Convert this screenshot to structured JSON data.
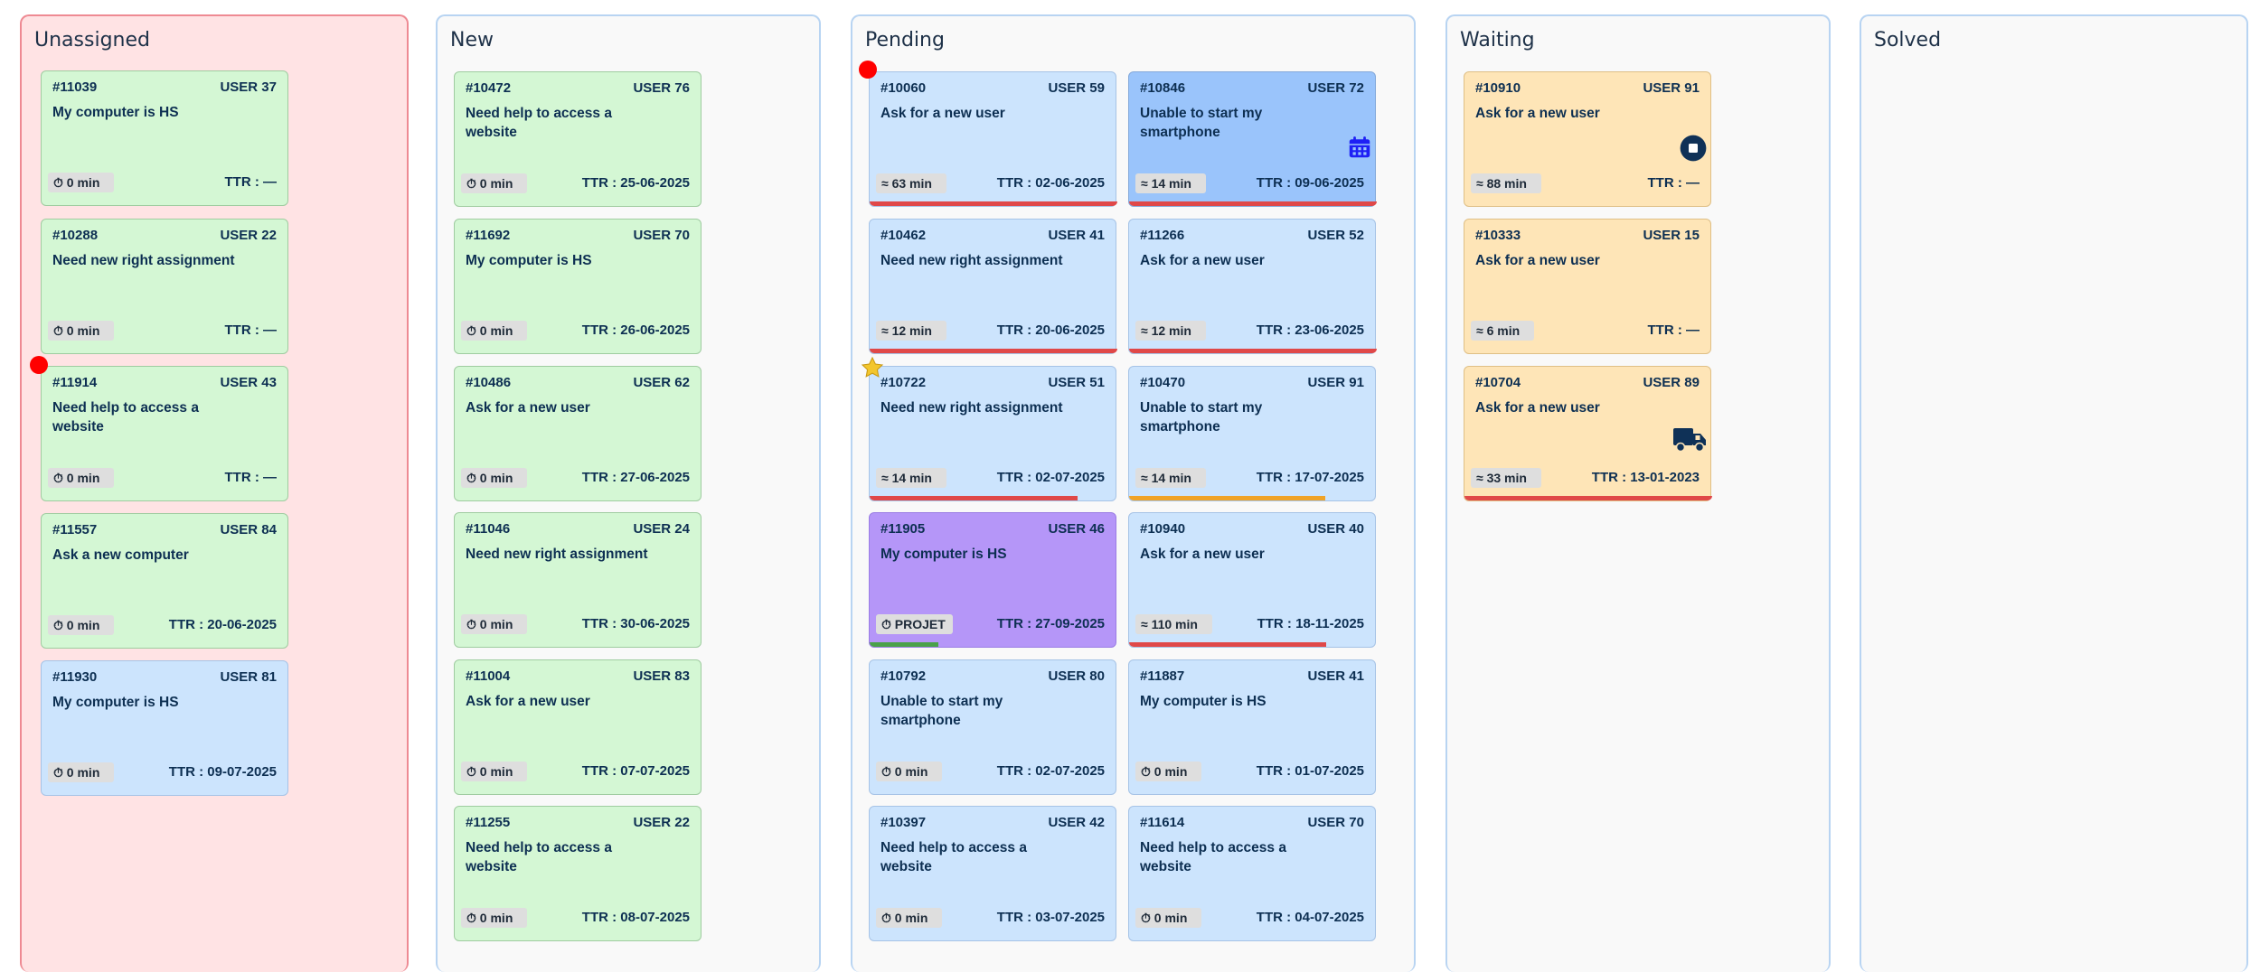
{
  "colors": {
    "unassigned_bg": "#ffe3e4",
    "green_card": "#d4f7d4",
    "blue_card": "#cce4fd",
    "darkblue_card": "#9ac4fb",
    "purple_card": "#b596f8",
    "orange_card": "#fee5b7",
    "bar_red": "#e04848",
    "bar_orange": "#f0a327",
    "bar_green": "#4aa14a",
    "marker_red": "#ff0000"
  },
  "columns": [
    {
      "title": "Unassigned"
    },
    {
      "title": "New"
    },
    {
      "title": "Pending"
    },
    {
      "title": "Waiting"
    },
    {
      "title": "Solved"
    }
  ],
  "unassigned": [
    {
      "id": "#11039",
      "user": "USER 37",
      "title": "My computer is HS",
      "time": "⏱ 0 min",
      "ttr": "TTR : —"
    },
    {
      "id": "#10288",
      "user": "USER 22",
      "title": "Need new right assignment",
      "time": "⏱ 0 min",
      "ttr": "TTR : —"
    },
    {
      "id": "#11914",
      "user": "USER 43",
      "title": "Need help to access a website",
      "time": "⏱ 0 min",
      "ttr": "TTR : —"
    },
    {
      "id": "#11557",
      "user": "USER 84",
      "title": "Ask a new computer",
      "time": "⏱ 0 min",
      "ttr": "TTR : 20-06-2025"
    },
    {
      "id": "#11930",
      "user": "USER 81",
      "title": "My computer is HS",
      "time": "⏱ 0 min",
      "ttr": "TTR : 09-07-2025"
    }
  ],
  "new": [
    {
      "id": "#10472",
      "user": "USER 76",
      "title": "Need help to access a website",
      "time": "⏱ 0 min",
      "ttr": "TTR : 25-06-2025"
    },
    {
      "id": "#11692",
      "user": "USER 70",
      "title": "My computer is HS",
      "time": "⏱ 0 min",
      "ttr": "TTR : 26-06-2025"
    },
    {
      "id": "#10486",
      "user": "USER 62",
      "title": "Ask for a new user",
      "time": "⏱ 0 min",
      "ttr": "TTR : 27-06-2025"
    },
    {
      "id": "#11046",
      "user": "USER 24",
      "title": "Need new right assignment",
      "time": "⏱ 0 min",
      "ttr": "TTR : 30-06-2025"
    },
    {
      "id": "#11004",
      "user": "USER 83",
      "title": "Ask for a new user",
      "time": "⏱ 0 min",
      "ttr": "TTR : 07-07-2025"
    },
    {
      "id": "#11255",
      "user": "USER 22",
      "title": "Need help to access a website",
      "time": "⏱ 0 min",
      "ttr": "TTR : 08-07-2025"
    }
  ],
  "pending_left": [
    {
      "id": "#10060",
      "user": "USER 59",
      "title": "Ask for a new user",
      "time": "≈ 63 min",
      "ttr": "TTR : 02-06-2025"
    },
    {
      "id": "#10462",
      "user": "USER 41",
      "title": "Need new right assignment",
      "time": "≈ 12 min",
      "ttr": "TTR : 20-06-2025"
    },
    {
      "id": "#10722",
      "user": "USER 51",
      "title": "Need new right assignment",
      "time": "≈ 14 min",
      "ttr": "TTR : 02-07-2025"
    },
    {
      "id": "#11905",
      "user": "USER 46",
      "title": "My computer is HS",
      "time": "⏱ PROJET",
      "ttr": "TTR : 27-09-2025"
    },
    {
      "id": "#10792",
      "user": "USER 80",
      "title": "Unable to start my smartphone",
      "time": "⏱ 0 min",
      "ttr": "TTR : 02-07-2025"
    },
    {
      "id": "#10397",
      "user": "USER 42",
      "title": "Need help to access a website",
      "time": "⏱ 0 min",
      "ttr": "TTR : 03-07-2025"
    }
  ],
  "pending_right": [
    {
      "id": "#10846",
      "user": "USER 72",
      "title": "Unable to start my smartphone",
      "time": "≈ 14 min",
      "ttr": "TTR : 09-06-2025",
      "icon": "calendar-icon"
    },
    {
      "id": "#11266",
      "user": "USER 52",
      "title": "Ask for a new user",
      "time": "≈ 12 min",
      "ttr": "TTR : 23-06-2025"
    },
    {
      "id": "#10470",
      "user": "USER 91",
      "title": "Unable to start my smartphone",
      "time": "≈ 14 min",
      "ttr": "TTR : 17-07-2025"
    },
    {
      "id": "#10940",
      "user": "USER 40",
      "title": "Ask for a new user",
      "time": "≈ 110 min",
      "ttr": "TTR : 18-11-2025"
    },
    {
      "id": "#11887",
      "user": "USER 41",
      "title": "My computer is HS",
      "time": "⏱ 0 min",
      "ttr": "TTR : 01-07-2025"
    },
    {
      "id": "#11614",
      "user": "USER 70",
      "title": "Need help to access a website",
      "time": "⏱ 0 min",
      "ttr": "TTR : 04-07-2025"
    }
  ],
  "waiting": [
    {
      "id": "#10910",
      "user": "USER 91",
      "title": "Ask for a new user",
      "time": "≈ 88 min",
      "ttr": "TTR : —",
      "icon": "stop-icon"
    },
    {
      "id": "#10333",
      "user": "USER 15",
      "title": "Ask for a new user",
      "time": "≈ 6 min",
      "ttr": "TTR : —"
    },
    {
      "id": "#10704",
      "user": "USER 89",
      "title": "Ask for a new user",
      "time": "≈ 33 min",
      "ttr": "TTR : 13-01-2023",
      "icon": "truck-icon"
    }
  ]
}
